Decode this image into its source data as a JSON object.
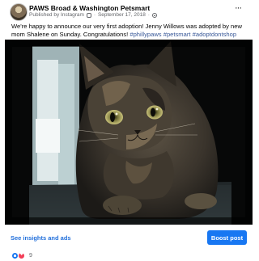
{
  "post": {
    "page_name": "PAWS Broad & Washington Petsmart",
    "published_by": "Published by Instagram",
    "instagram_icon": "instagram-icon",
    "date": "September 17, 2018",
    "privacy_icon": "globe-icon",
    "more_label": "···",
    "text_before_tags": "We're happy to announce our very first adoption! Jenny Willows was adopted by new mom Shalene on Sunday. Congratulations! ",
    "hashtags": [
      "#phillypaws",
      "#petsmart",
      "#adoptdontshop"
    ],
    "photo_subject": "tortoiseshell cat"
  },
  "footer": {
    "insights_label": "See insights and ads",
    "boost_label": "Boost post"
  },
  "reactions": {
    "types": [
      "like",
      "love"
    ],
    "count": "9"
  },
  "colors": {
    "link": "#216fdb",
    "hashtag": "#385898",
    "boost_button": "#1877f2",
    "meta_text": "#65676b"
  }
}
